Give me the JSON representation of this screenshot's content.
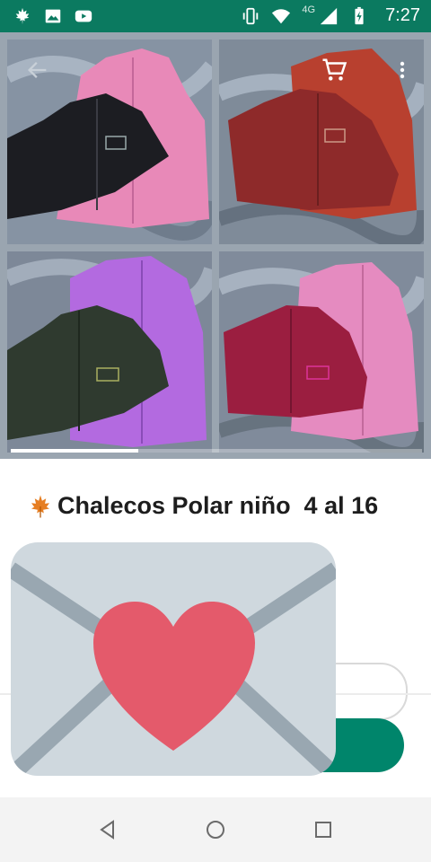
{
  "status_bar": {
    "time": "7:27",
    "network_type": "4G",
    "left_icons": [
      "maple-leaf-icon",
      "image-icon",
      "youtube-icon"
    ],
    "right_icons": [
      "vibrate-icon",
      "wifi-icon",
      "signal-icon",
      "battery-charging-icon"
    ]
  },
  "gallery": {
    "images": [
      {
        "name": "vest-black-pink",
        "colors": [
          "#1c1d22",
          "#e889b8"
        ]
      },
      {
        "name": "vest-red-rust",
        "colors": [
          "#8e2a2a",
          "#b8402f"
        ]
      },
      {
        "name": "vest-green-purple",
        "colors": [
          "#2f3a2f",
          "#b36ae0"
        ]
      },
      {
        "name": "vest-crimson-pink",
        "colors": [
          "#9b1e40",
          "#e58bc0"
        ]
      }
    ],
    "current_page_fraction": 0.31
  },
  "product": {
    "title": "Chalecos Polar niño  4 al 16",
    "emoji_icon": "maple-leaf-icon"
  },
  "colors": {
    "status_bar": "#0b7a60",
    "accent": "#00856b",
    "sticker_heart": "#e45a6b",
    "sticker_envelope": "#cfd8de"
  }
}
